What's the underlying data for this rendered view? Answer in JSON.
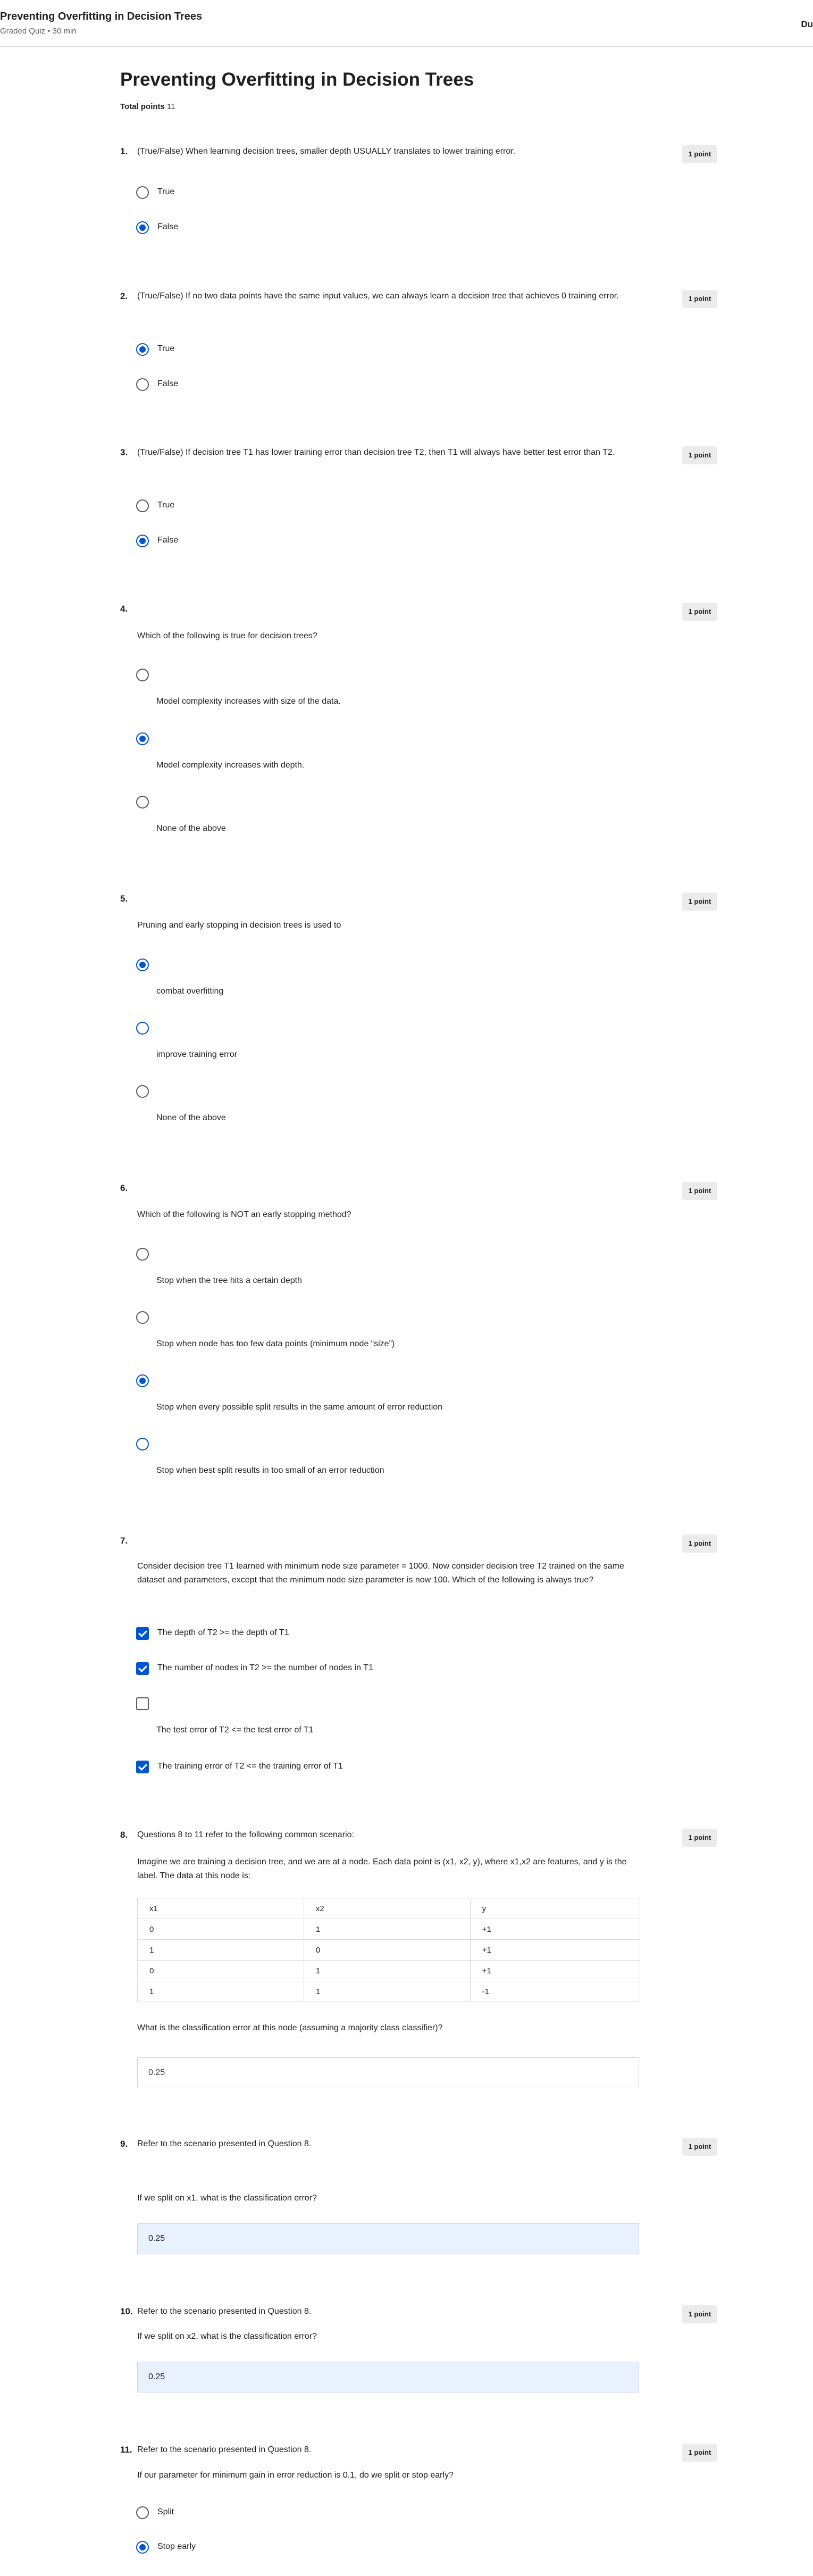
{
  "header": {
    "title": "Preventing Overfitting in Decision Trees",
    "subtitle": "Graded Quiz • 30 min",
    "due": "Du"
  },
  "page": {
    "title": "Preventing Overfitting in Decision Trees",
    "total_label": "Total points",
    "total_value": "11"
  },
  "q1": {
    "num": "1.",
    "text": "(True/False) When learning decision trees, smaller depth USUALLY translates to lower training error.",
    "points": "1 point",
    "options": [
      "True",
      "False"
    ],
    "selected": "False"
  },
  "q2": {
    "num": "2.",
    "text": "(True/False) If no two data points have the same input values, we can always learn a decision tree that achieves 0 training error.",
    "points": "1 point",
    "options": [
      "True",
      "False"
    ],
    "selected": "True"
  },
  "q3": {
    "num": "3.",
    "text": "(True/False) If decision tree T1 has lower training error than decision tree T2, then T1 will always have better test error than T2.",
    "points": "1 point",
    "options": [
      "True",
      "False"
    ],
    "selected": "False"
  },
  "q4": {
    "num": "4.",
    "text": "Which of the following is true for decision trees?",
    "points": "1 point",
    "options": [
      "Model complexity increases with size of the data.",
      "Model complexity increases with depth.",
      "None of the above"
    ],
    "selected": "Model complexity increases with depth."
  },
  "q5": {
    "num": "5.",
    "text": "Pruning and early stopping in decision trees is used to",
    "points": "1 point",
    "options": [
      "combat overfitting",
      "improve training error",
      "None of the above"
    ],
    "selected": "combat overfitting"
  },
  "q6": {
    "num": "6.",
    "text": "Which of the following is NOT an early stopping method?",
    "points": "1 point",
    "options": [
      "Stop when the tree hits a certain depth",
      "Stop when node has too few data points (minimum node “size”)",
      "Stop when every possible split results in the same amount of error reduction",
      "Stop when best split results in too small of an error reduction"
    ],
    "selected": "Stop when every possible split results in the same amount of error reduction"
  },
  "q7": {
    "num": "7.",
    "text": "Consider decision tree T1 learned with minimum node size parameter = 1000. Now consider decision tree T2 trained on the same dataset and parameters, except that the minimum node size parameter is now 100. Which of the following is always true?",
    "points": "1 point",
    "options": [
      "The depth of T2 >= the depth of T1",
      "The number of nodes in T2 >= the number of nodes in T1",
      "The test error of T2 <= the test error of T1",
      "The training error of T2 <= the training error of T1"
    ],
    "checked": [
      true,
      true,
      false,
      true
    ]
  },
  "q8": {
    "num": "8.",
    "text": "Questions 8 to 11 refer to the following common scenario:",
    "scenario": "Imagine we are training a decision tree, and we are at a node. Each data point is (x1, x2, y), where x1,x2 are features, and y is the label. The data at this node is:",
    "points": "1 point",
    "table": {
      "headers": [
        "x1",
        "x2",
        "y"
      ],
      "rows": [
        [
          "0",
          "1",
          "+1"
        ],
        [
          "1",
          "0",
          "+1"
        ],
        [
          "0",
          "1",
          "+1"
        ],
        [
          "1",
          "1",
          "-1"
        ]
      ]
    },
    "prompt": "What is the classification error at this node (assuming a majority class classifier)?",
    "answer": "0.25"
  },
  "q9": {
    "num": "9.",
    "text": "Refer to the scenario presented in Question 8.",
    "prompt": "If we split on x1, what is the classification error?",
    "points": "1 point",
    "answer": "0.25"
  },
  "q10": {
    "num": "10.",
    "text": "Refer to the scenario presented in Question 8.",
    "prompt": "If we split on x2, what is the classification error?",
    "points": "1 point",
    "answer": "0.25"
  },
  "q11": {
    "num": "11.",
    "text": "Refer to the scenario presented in Question 8.",
    "prompt": "If our parameter for minimum gain in error reduction is 0.1, do we split or stop early?",
    "points": "1 point",
    "options": [
      "Split",
      "Stop early"
    ],
    "selected": "Stop early"
  },
  "colors": {
    "accent": "#0056d2",
    "answer_fill": "#e8f1fd",
    "points_badge": "#ebebeb"
  }
}
